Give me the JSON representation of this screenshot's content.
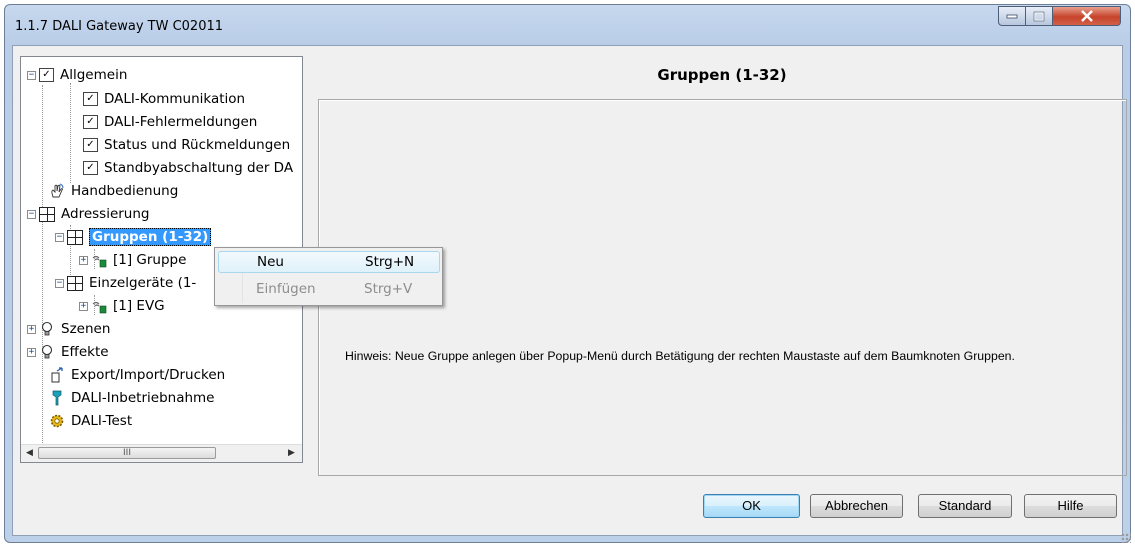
{
  "window": {
    "title": "1.1.7 DALI Gateway TW C02011",
    "controls": {
      "minimize": "–",
      "maximize": "□",
      "close": "X"
    }
  },
  "tree": {
    "items": [
      {
        "label": "Allgemein",
        "icon": "checklist-icon",
        "expander": "−"
      },
      {
        "label": "DALI-Kommunikation",
        "icon": "checklist-icon"
      },
      {
        "label": "DALI-Fehlermeldungen",
        "icon": "checklist-icon"
      },
      {
        "label": "Status und Rückmeldungen",
        "icon": "checklist-icon"
      },
      {
        "label": "Standbyabschaltung der DA",
        "icon": "checklist-icon"
      },
      {
        "label": "Handbedienung",
        "icon": "hand-icon"
      },
      {
        "label": "Adressierung",
        "icon": "grid-icon",
        "expander": "−"
      },
      {
        "label": "Gruppen (1-32)",
        "icon": "grid-icon",
        "expander": "−",
        "selected": true
      },
      {
        "label": "[1] Gruppe",
        "icon": "device-icon",
        "expander": "+"
      },
      {
        "label": "Einzelgeräte (1-",
        "icon": "grid-icon",
        "expander": "−"
      },
      {
        "label": "[1] EVG",
        "icon": "device-icon",
        "expander": "+"
      },
      {
        "label": "Szenen",
        "icon": "bulb-icon",
        "expander": "+"
      },
      {
        "label": "Effekte",
        "icon": "bulb-icon",
        "expander": "+"
      },
      {
        "label": "Export/Import/Drucken",
        "icon": "export-icon"
      },
      {
        "label": "DALI-Inbetriebnahme",
        "icon": "tool-icon"
      },
      {
        "label": "DALI-Test",
        "icon": "gear-icon"
      }
    ],
    "scrollbar": {
      "left": "◀",
      "right": "▶",
      "thumb": "III"
    }
  },
  "context_menu": {
    "items": [
      {
        "label": "Neu",
        "shortcut": "Strg+N",
        "enabled": true
      },
      {
        "label": "Einfügen",
        "shortcut": "Strg+V",
        "enabled": false
      }
    ]
  },
  "main": {
    "title": "Gruppen (1-32)",
    "hint": "Hinweis: Neue Gruppe anlegen über Popup-Menü durch Betätigung der rechten  Maustaste auf dem Baumknoten Gruppen."
  },
  "buttons": {
    "ok": "OK",
    "cancel": "Abbrechen",
    "standard": "Standard",
    "help": "Hilfe"
  }
}
